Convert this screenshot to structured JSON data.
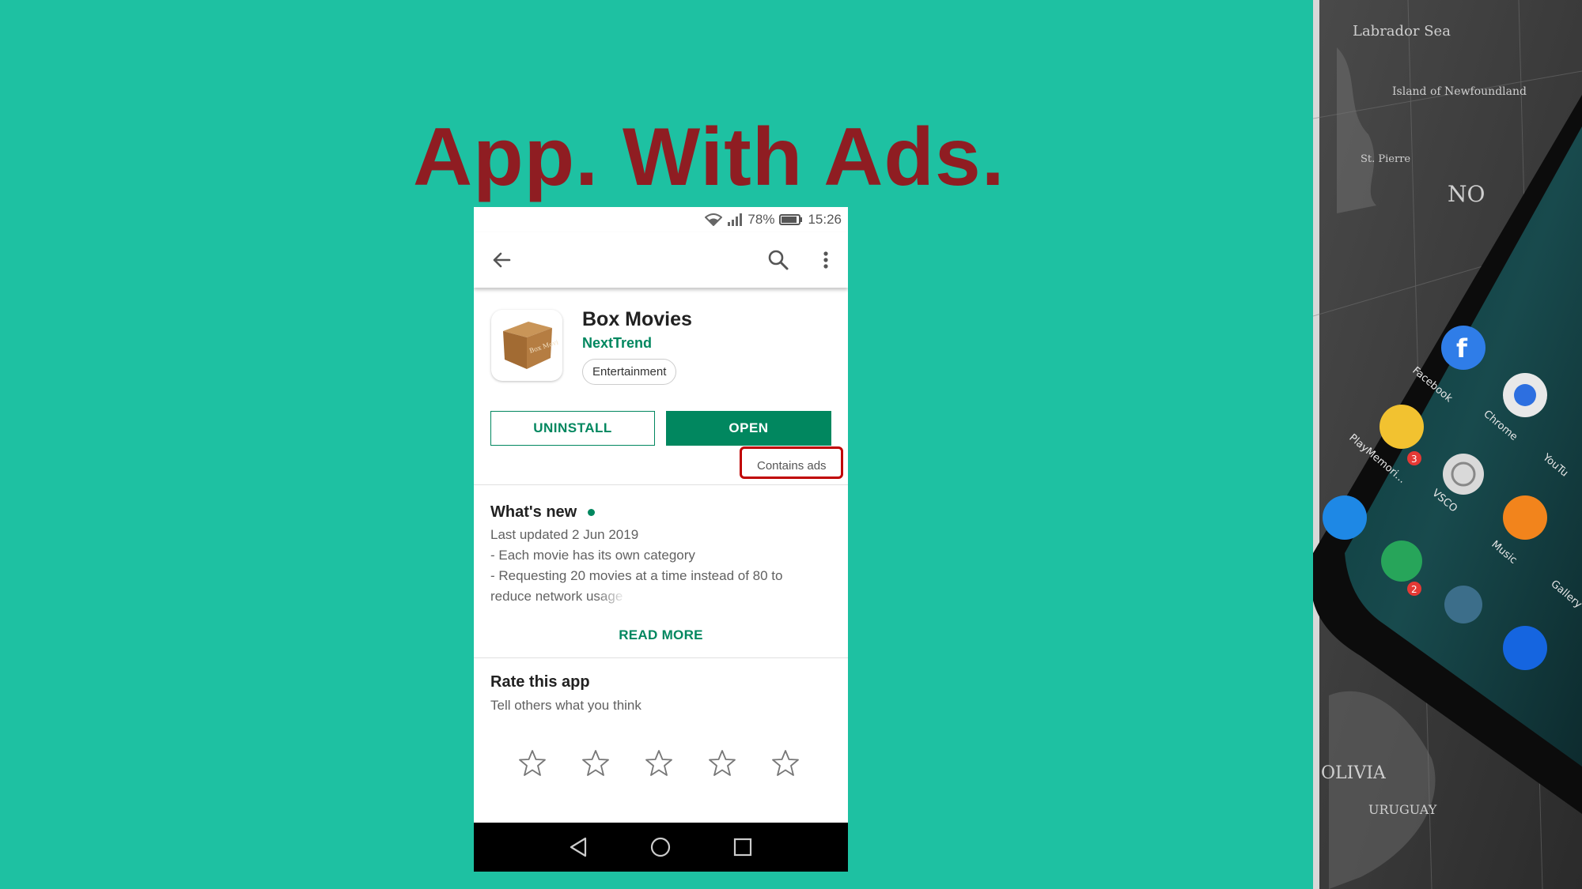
{
  "slide": {
    "title": "App. With Ads."
  },
  "status_bar": {
    "battery": "78%",
    "time": "15:26",
    "icons": [
      "wifi-icon",
      "signal-icon",
      "battery-icon"
    ]
  },
  "toolbar": {
    "icons": [
      "back-arrow-icon",
      "search-icon",
      "more-vert-icon"
    ]
  },
  "app": {
    "name": "Box Movies",
    "developer": "NextTrend",
    "category": "Entertainment",
    "icon": "box-movies-icon",
    "icon_text": "Box Movies"
  },
  "actions": {
    "uninstall_label": "UNINSTALL",
    "open_label": "OPEN",
    "ads_label": "Contains ads"
  },
  "whats_new": {
    "title": "What's new",
    "updated": "Last updated 2 Jun 2019",
    "line1": "- Each movie has its own category",
    "line2": "- Requesting 20 movies at a time instead of 80 to",
    "line3": "reduce network usage",
    "read_more": "READ MORE"
  },
  "rating": {
    "title": "Rate this app",
    "subtitle": "Tell others what you think",
    "stars_count": 5
  },
  "nav_bar": {
    "icons": [
      "nav-back-icon",
      "nav-home-icon",
      "nav-recents-icon"
    ]
  },
  "photo": {
    "map_labels": [
      "Labrador Sea",
      "Island of Newfoundland",
      "St. Pierre",
      "NO",
      "OLIVIA",
      "URUGUAY"
    ],
    "app_labels": [
      "Facebook",
      "Chrome",
      "PlayMemori...",
      "VSCO",
      "YouTu",
      "Music",
      "Gallery"
    ],
    "badges": [
      "3",
      "2"
    ]
  },
  "colors": {
    "background": "#1ec1a2",
    "title": "#8f1d22",
    "accent": "#01875f",
    "ads_highlight": "#c00000"
  }
}
